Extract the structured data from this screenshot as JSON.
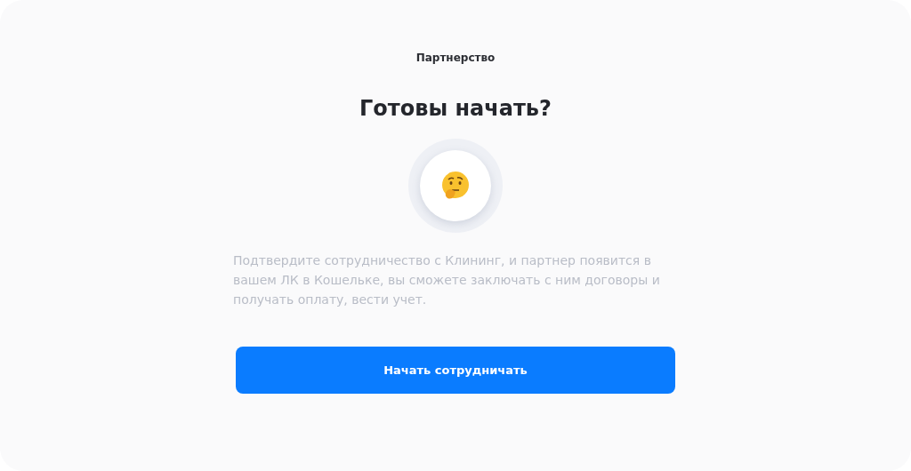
{
  "header": {
    "title": "Партнерство"
  },
  "heading": "Готовы начать?",
  "description": "Подтвердите сотрудничество с Клининг, и партнер появится в вашем ЛК в Кошельке, вы сможете заключать с ним договоры и получать оплату, вести учет.",
  "button": {
    "label": "Начать сотрудничать"
  }
}
